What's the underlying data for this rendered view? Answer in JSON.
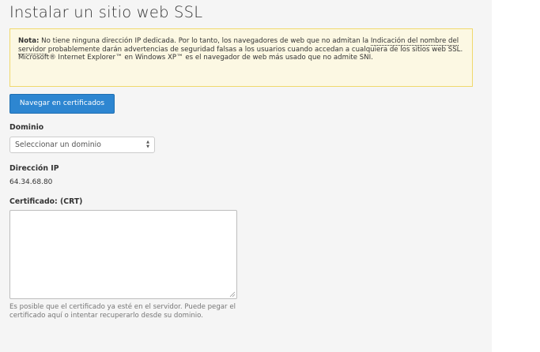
{
  "page": {
    "title": "Instalar un sitio web SSL"
  },
  "alert": {
    "title": "Nota:",
    "text_1": " No tiene ninguna dirección IP dedicada. Por lo tanto, los navegadores de web que no admitan la ",
    "sni_link": "Indicación del nombre del servidor",
    "text_2": " probablemente darán advertencias de seguridad falsas a los usuarios cuando accedan a cualquiera de los sitios web SSL. Microsoft® Internet Explorer™ en Windows XP™ es el navegador de web más usado que no admite SNI.",
    "background_color": "#fcf8e3",
    "border_color": "#f0d96c"
  },
  "actions": {
    "browse_certificates_label": "Navegar en certificados",
    "button_color": "#2d86d1"
  },
  "form": {
    "domain": {
      "label": "Dominio",
      "selected_value": "Seleccionar un dominio"
    },
    "ip": {
      "label": "Dirección IP",
      "value": "64.34.68.80"
    },
    "certificate": {
      "label": "Certificado: (CRT)",
      "value": "",
      "help": "Es posible que el certificado ya esté en el servidor. Puede pegar el certificado aquí o intentar recuperarlo desde su dominio."
    }
  }
}
